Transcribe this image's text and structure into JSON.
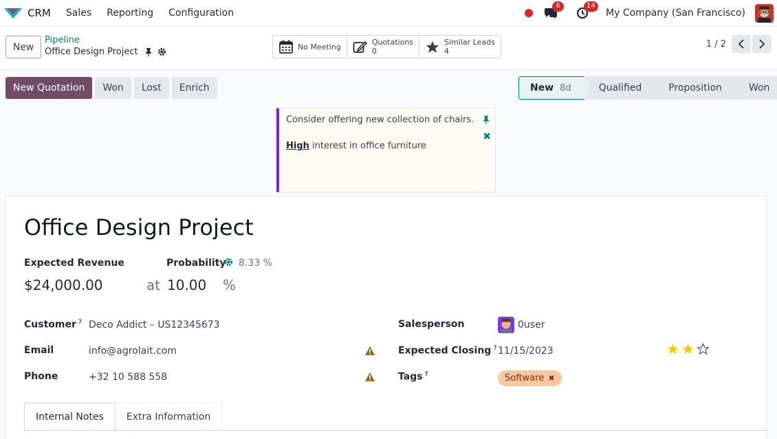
{
  "nav": {
    "app_name": "CRM",
    "menu": [
      "Sales",
      "Reporting",
      "Configuration"
    ],
    "messages_count": "6",
    "activities_count": "14",
    "company": "My Company (San Francisco)"
  },
  "control": {
    "new_label": "New",
    "breadcrumb_parent": "Pipeline",
    "breadcrumb_current": "Office Design Project",
    "smart_buttons": [
      {
        "label": "No Meeting",
        "value": ""
      },
      {
        "label": "Quotations",
        "value": "0"
      },
      {
        "label": "Similar Leads",
        "value": "4"
      }
    ],
    "pager": "1 / 2"
  },
  "actions": [
    "New Quotation",
    "Won",
    "Lost",
    "Enrich"
  ],
  "stages": [
    {
      "label": "New",
      "duration": "8d"
    },
    {
      "label": "Qualified"
    },
    {
      "label": "Proposition"
    },
    {
      "label": "Won"
    }
  ],
  "note": {
    "line1": "Consider offering new collection of chairs.",
    "highlight": "High",
    "line2_rest": " interest in office furniture"
  },
  "form": {
    "title": "Office Design Project",
    "expected_revenue_label": "Expected Revenue",
    "probability_label": "Probability",
    "auto_probability": "8.33 %",
    "revenue": "$24,000.00",
    "at": "at",
    "probability": "10.00",
    "percent": "%",
    "customer_label": "Customer",
    "customer": "Deco Addict – US12345673",
    "email_label": "Email",
    "email": "info@agrolait.com",
    "phone_label": "Phone",
    "phone": "+32 10 588 558",
    "salesperson_label": "Salesperson",
    "salesperson": "0user",
    "closing_label": "Expected Closing",
    "closing": "11/15/2023",
    "tags_label": "Tags",
    "tag": "Software",
    "hint": "?",
    "priority_stars": 2,
    "priority_max": 3
  },
  "tabs": [
    "Internal Notes",
    "Extra Information"
  ],
  "colors": {
    "primary": "#714b67",
    "accent": "#017e84",
    "warning": "#8a6d1f",
    "badge": "#dc2626",
    "note_border": "#7e22ce"
  }
}
